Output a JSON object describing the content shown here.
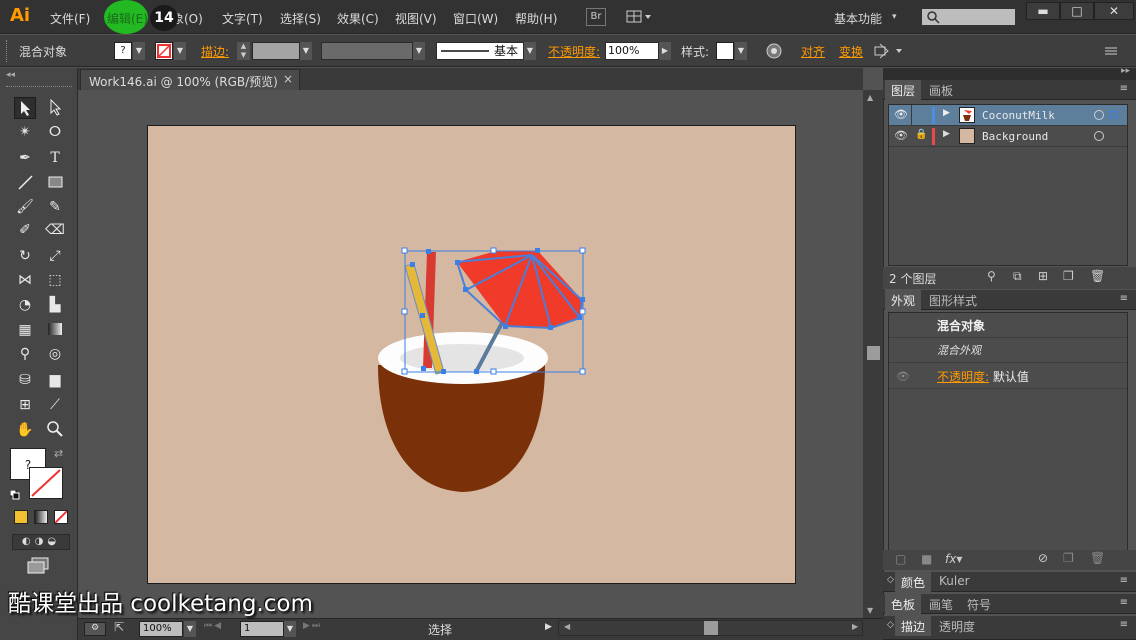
{
  "app": {
    "logo": "Ai"
  },
  "menu": {
    "items": [
      "文件(F)",
      "编辑(E)",
      "对象(O)",
      "文字(T)",
      "选择(S)",
      "效果(C)",
      "视图(V)",
      "窗口(W)",
      "帮助(H)"
    ],
    "object_visible": "象(O)",
    "step_badge": "14",
    "bridge": "Br",
    "workspace": "基本功能"
  },
  "control_bar": {
    "selection_type": "混合对象",
    "stroke_label": "描边:",
    "stroke_style": "基本",
    "opacity_label": "不透明度:",
    "opacity_value": "100%",
    "style_label": "样式:",
    "align_label": "对齐",
    "transform_label": "变换"
  },
  "document": {
    "tab_title": "Work146.ai @ 100% (RGB/预览)",
    "close": "×"
  },
  "tools": {
    "fill_placeholder": "?"
  },
  "status_bar": {
    "zoom": "100%",
    "page": "1",
    "tool": "选择"
  },
  "layers_panel": {
    "tabs": [
      "图层",
      "画板"
    ],
    "layers": [
      {
        "name": "CoconutMilk",
        "color": "#4a90e2",
        "selected": true
      },
      {
        "name": "Background",
        "color": "#e84b4b",
        "selected": false
      }
    ],
    "count": "2 个图层"
  },
  "appearance_panel": {
    "tabs": [
      "外观",
      "图形样式"
    ],
    "object_type": "混合对象",
    "mixed": "混合外观",
    "opacity_label": "不透明度:",
    "opacity_value": "默认值"
  },
  "bottom_panels": {
    "row1": [
      "颜色",
      "Kuler"
    ],
    "row2": [
      "色板",
      "画笔",
      "符号"
    ],
    "row3": [
      "描边",
      "透明度"
    ]
  },
  "watermark": "酷课堂出品 coolketang.com",
  "colors": {
    "artboard": "#d4b8a2",
    "coconut_shell": "#7a3008",
    "umbrella": "#f03a2a",
    "straw_yellow": "#e5b83a",
    "straw_red": "#d83a32",
    "selection": "#3a7fe8",
    "accent_orange": "#ff9a00"
  }
}
